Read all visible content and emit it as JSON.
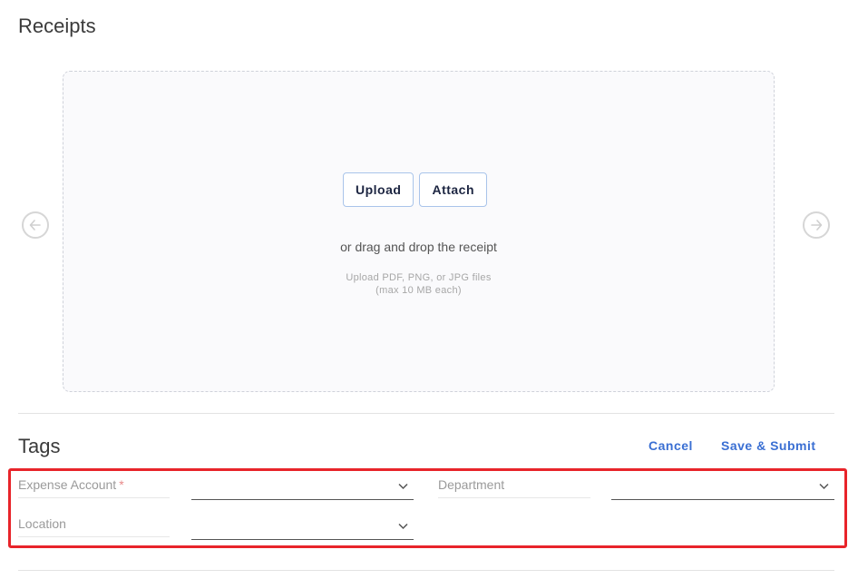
{
  "receipts": {
    "title": "Receipts",
    "upload_label": "Upload",
    "attach_label": "Attach",
    "drag_text": "or drag and drop the receipt",
    "hint_line1": "Upload PDF, PNG, or JPG files",
    "hint_line2": "(max 10 MB each)",
    "prev_icon": "arrow-left-circle-icon",
    "next_icon": "arrow-right-circle-icon"
  },
  "tags": {
    "title": "Tags",
    "cancel_label": "Cancel",
    "submit_label": "Save & Submit",
    "fields": [
      {
        "label": "Expense Account",
        "required": true,
        "value": ""
      },
      {
        "label": "Department",
        "required": false,
        "value": ""
      },
      {
        "label": "Location",
        "required": false,
        "value": ""
      }
    ],
    "required_marker": "*"
  },
  "colors": {
    "accent": "#3a6fd3",
    "highlight": "#e8242a",
    "button_border": "#a9c4ea"
  }
}
